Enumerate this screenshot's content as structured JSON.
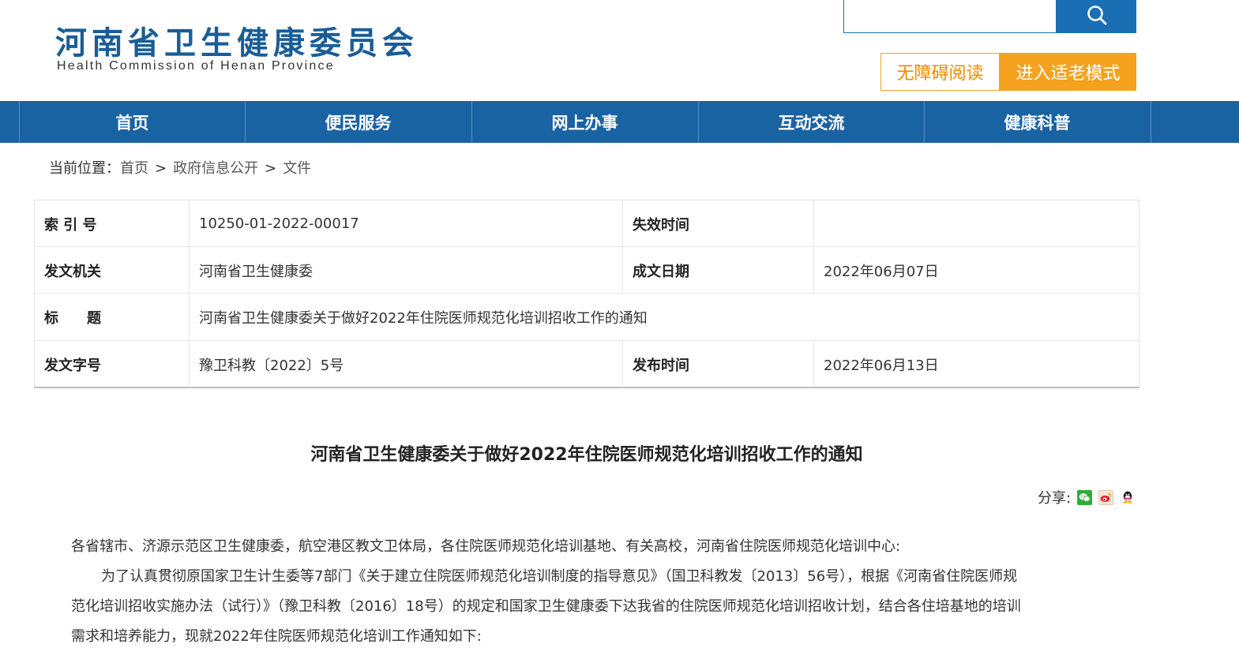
{
  "header": {
    "logo_cn": "河南省卫生健康委员会",
    "logo_en": "Health Commission of Henan Province",
    "search_placeholder": "",
    "accessibility_label": "无障碍阅读",
    "elder_mode_label": "进入适老模式",
    "colors": {
      "brand_blue": "#1a63a3",
      "accent_orange": "#f5a21f"
    }
  },
  "nav": {
    "items": [
      {
        "label": "首页"
      },
      {
        "label": "便民服务"
      },
      {
        "label": "网上办事"
      },
      {
        "label": "互动交流"
      },
      {
        "label": "健康科普"
      }
    ]
  },
  "breadcrumb": {
    "prefix": "当前位置：",
    "items": [
      "首页",
      "政府信息公开",
      "文件"
    ],
    "separator": ">"
  },
  "meta": {
    "index_label": "索 引 号",
    "index_value": "10250-01-2022-00017",
    "expire_label": "失效时间",
    "expire_value": "",
    "issuer_label": "发文机关",
    "issuer_value": "河南省卫生健康委",
    "created_label": "成文日期",
    "created_value": "2022年06月07日",
    "title_label": "标　　题",
    "title_value": "河南省卫生健康委关于做好2022年住院医师规范化培训招收工作的通知",
    "docno_label": "发文字号",
    "docno_value": "豫卫科教〔2022〕5号",
    "publish_label": "发布时间",
    "publish_value": "2022年06月13日"
  },
  "article": {
    "title": "河南省卫生健康委关于做好2022年住院医师规范化培训招收工作的通知",
    "share_label": "分享:",
    "share_icons": [
      "wechat-icon",
      "weibo-icon",
      "qq-icon"
    ],
    "para1": "各省辖市、济源示范区卫生健康委，航空港区教文卫体局，各住院医师规范化培训基地、有关高校，河南省住院医师规范化培训中心:",
    "para2_line1": "为了认真贯彻原国家卫生计生委等7部门《关于建立住院医师规范化培训制度的指导意见》（国卫科教发〔2013〕56号），根据《河南省住院医师规",
    "para2_line2": "范化培训招收实施办法（试行）》（豫卫科教〔2016〕18号）的规定和国家卫生健康委下达我省的住院医师规范化培训招收计划，结合各住培基地的培训",
    "para2_line3": "需求和培养能力，现就2022年住院医师规范化培训工作通知如下:"
  }
}
